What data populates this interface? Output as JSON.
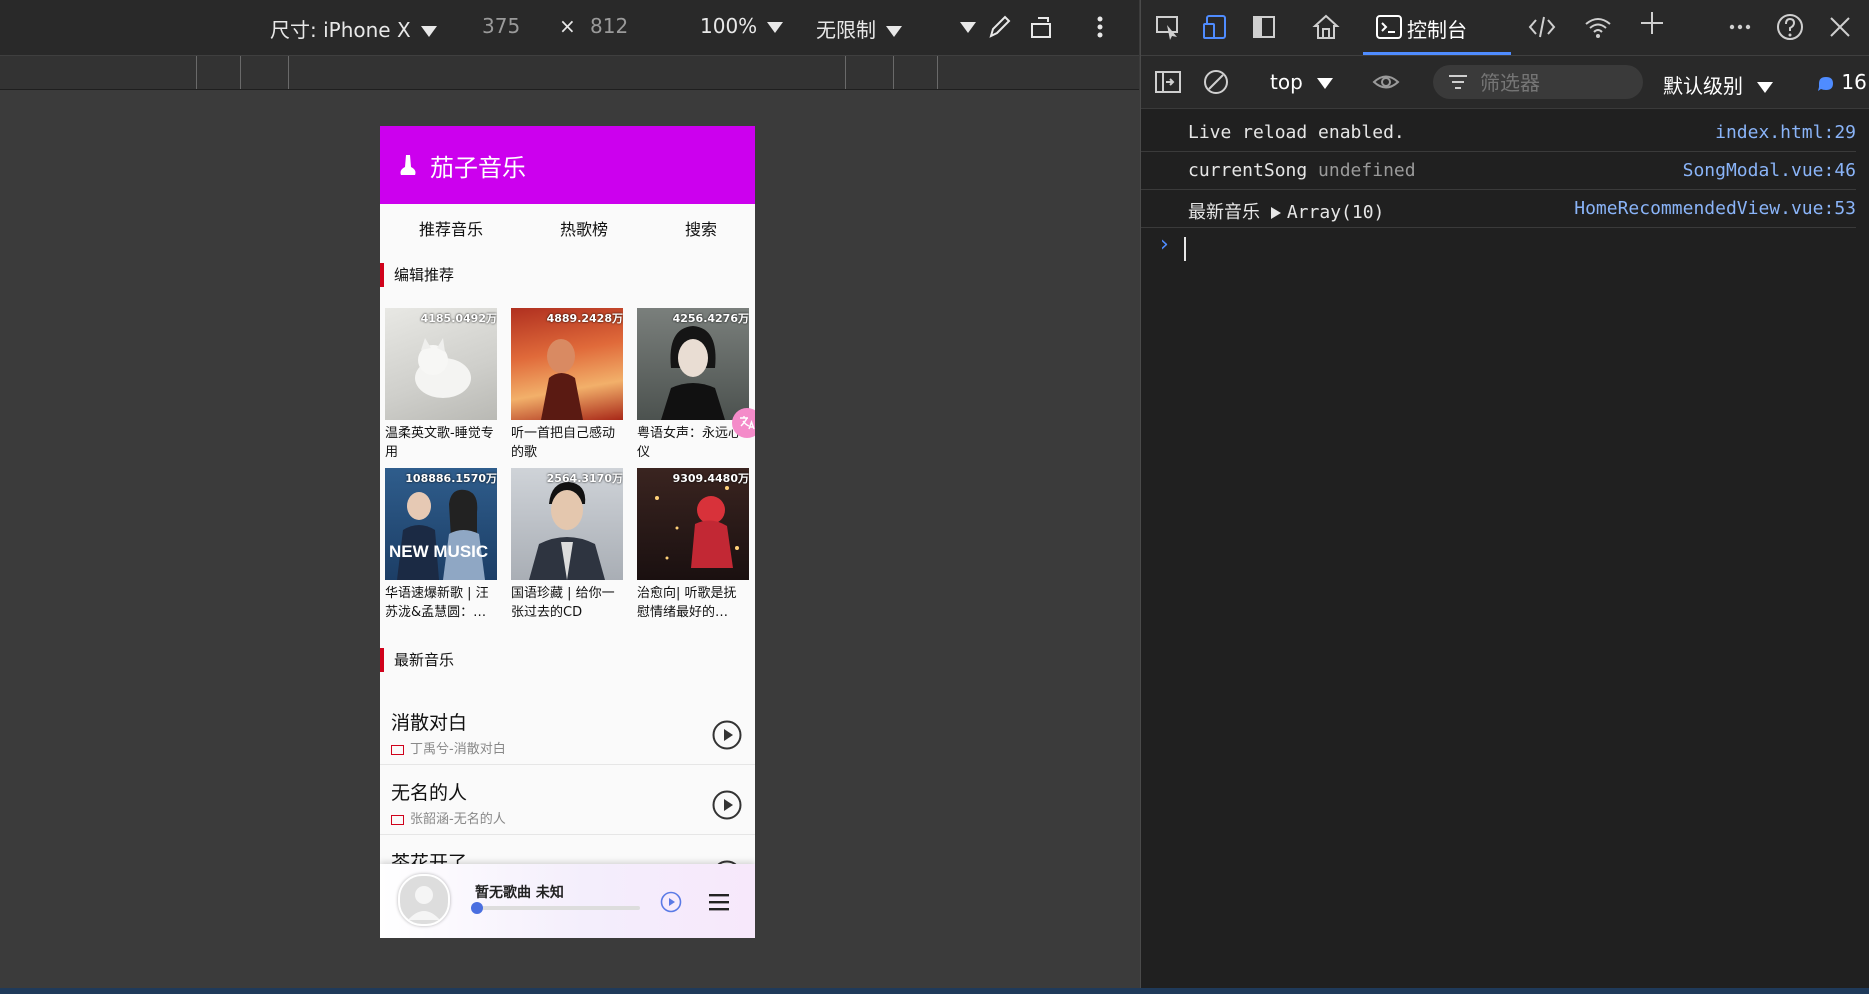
{
  "device_toolbar": {
    "dimensions_label": "尺寸: iPhone X",
    "width_value": "375",
    "times": "×",
    "height_value": "812",
    "zoom": "100%",
    "throttle": "无限制"
  },
  "app": {
    "title": "茄子音乐",
    "header_color": "#cc00ee",
    "tabs": [
      "推荐音乐",
      "热歌榜",
      "搜索"
    ],
    "section_recommend": "编辑推荐",
    "section_latest": "最新音乐",
    "playlists": [
      {
        "count": "4185.0492万",
        "name": "温柔英文歌-睡觉专用"
      },
      {
        "count": "4889.2428万",
        "name": "听一首把自己感动的歌"
      },
      {
        "count": "4256.4276万",
        "name": "粤语女声：永远心仪"
      },
      {
        "count": "108886.1570万",
        "name": "华语速爆新歌 | 汪苏泷&孟慧圆：…",
        "overlay": "NEW MUSIC"
      },
      {
        "count": "2564.3170万",
        "name": "国语珍藏 | 给你一张过去的CD"
      },
      {
        "count": "9309.4480万",
        "name": "治愈向| 听歌是抚慰情绪最好的…"
      }
    ],
    "songs": [
      {
        "title": "消散对白",
        "subtitle": "丁禹兮-消散对白"
      },
      {
        "title": "无名的人",
        "subtitle": "张韶涵-无名的人"
      },
      {
        "title": "茶花开了",
        "subtitle": ""
      }
    ],
    "player": {
      "song": "暂无歌曲",
      "artist": "未知",
      "progress": 0
    }
  },
  "devtools": {
    "tab_console": "控制台",
    "context": "top",
    "filter_placeholder": "筛选器",
    "level": "默认级别",
    "message_count": "16",
    "logs": [
      {
        "text": "Live reload enabled.",
        "extra": "",
        "source": "index.html:29"
      },
      {
        "text": "currentSong ",
        "extra": "undefined",
        "source": "SongModal.vue:46"
      },
      {
        "text": "最新音乐  ",
        "extra": "Array(10)",
        "source": "HomeRecommendedView.vue:53"
      }
    ],
    "prompt": "›"
  }
}
